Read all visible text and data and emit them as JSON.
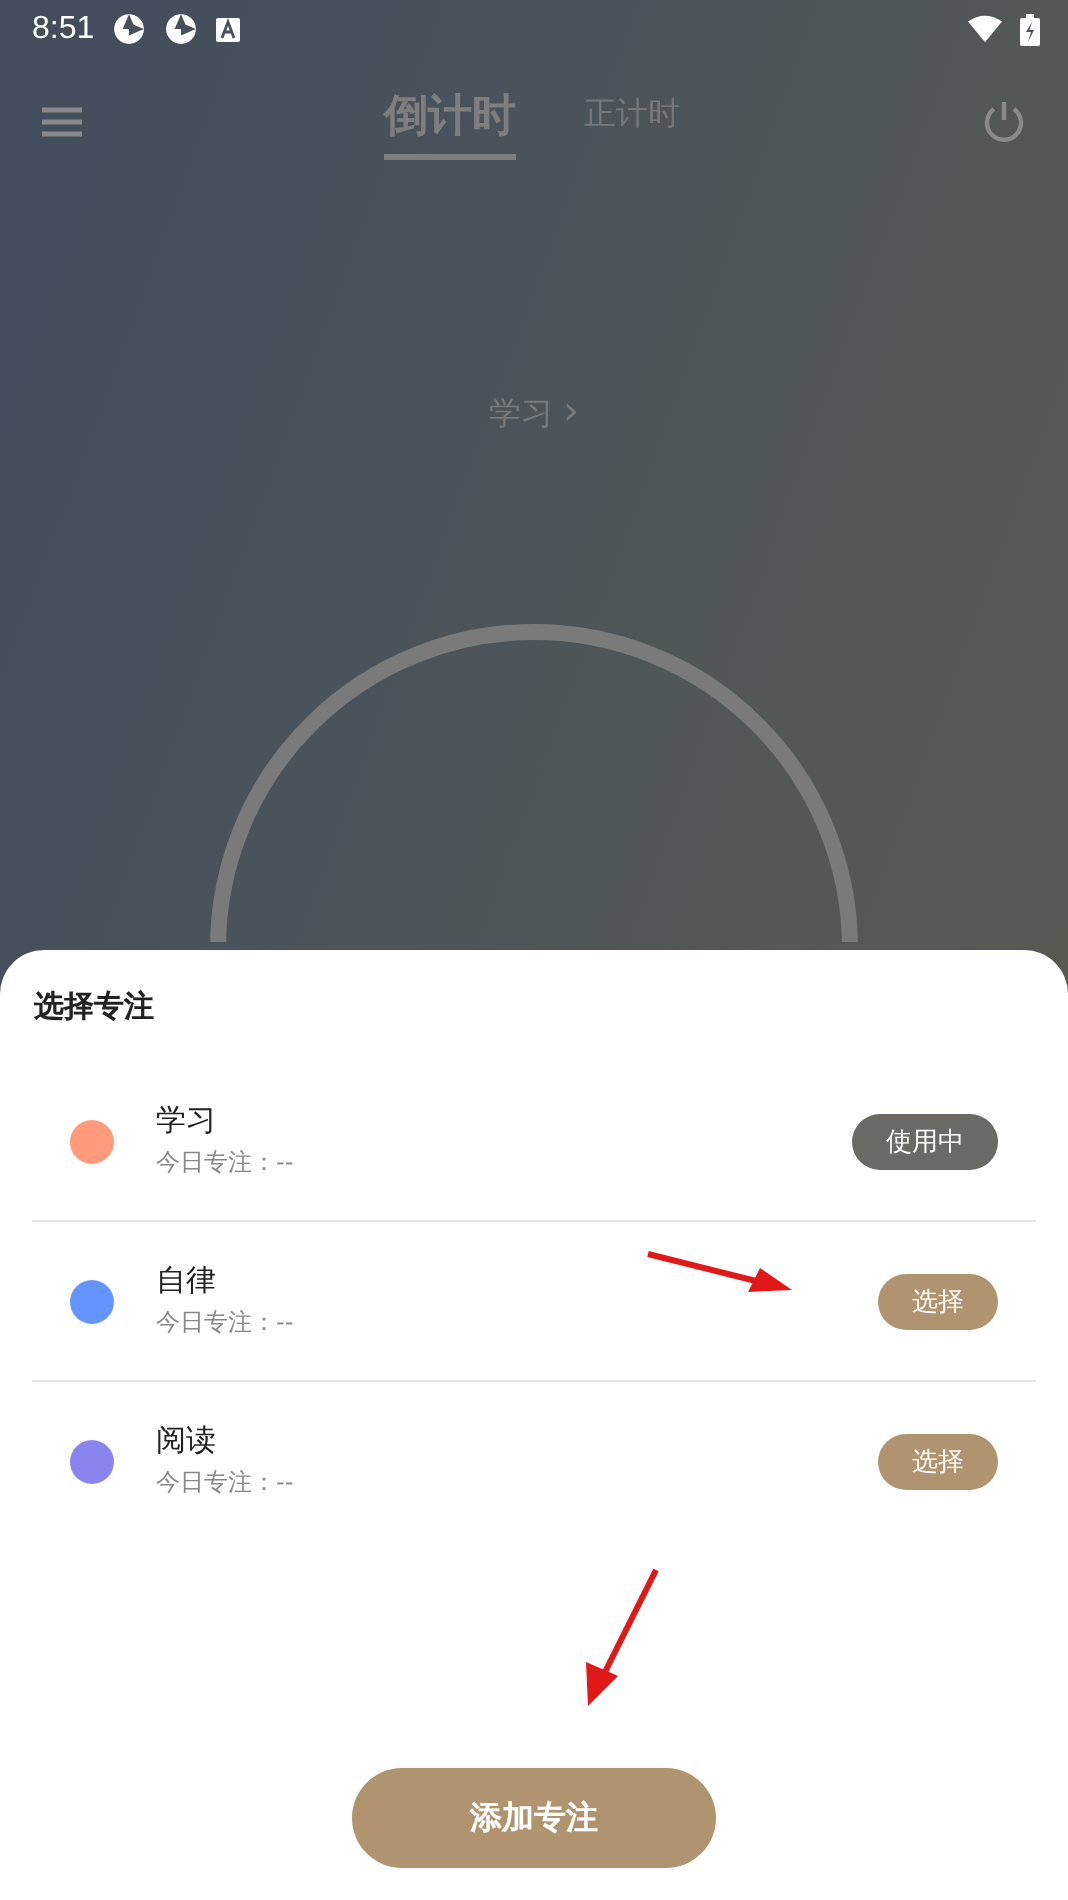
{
  "status_bar": {
    "time": "8:51"
  },
  "tabs": [
    {
      "label": "倒计时",
      "selected": true
    },
    {
      "label": "正计时",
      "selected": false
    }
  ],
  "current_focus": {
    "label": "学习",
    "chevron": "›"
  },
  "sheet": {
    "title": "选择专注",
    "items": [
      {
        "name": "学习",
        "today": "今日专注：--",
        "color": "#fe9b7c",
        "selected": true,
        "action": "使用中"
      },
      {
        "name": "自律",
        "today": "今日专注：--",
        "color": "#6495fe",
        "selected": false,
        "action": "选择"
      },
      {
        "name": "阅读",
        "today": "今日专注：--",
        "color": "#8c84ee",
        "selected": false,
        "action": "选择"
      }
    ],
    "add_button": "添加专注"
  }
}
